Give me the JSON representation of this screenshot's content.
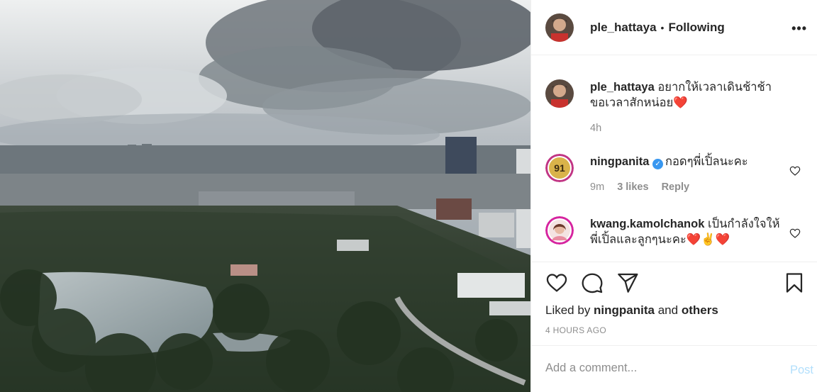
{
  "post": {
    "image_alt": "Aerial view of city skyline over a park with a lake under cloudy sky",
    "author": "ple_hattaya",
    "separator": "•",
    "follow_status": "Following",
    "more_icon": "more-options-icon",
    "caption": "อยากให้เวลาเดินช้าช้า ขอเวลาสักหน่อย❤️",
    "caption_time": "4h"
  },
  "comments": [
    {
      "username": "ningpanita",
      "verified": true,
      "text": "กอดๆพี่เปิ้ลนะคะ",
      "time": "9m",
      "likes": "3 likes",
      "reply": "Reply"
    },
    {
      "username": "kwang.kamolchanok",
      "verified": false,
      "text": "เป็นกำลังใจให้พี่เปิ้ลและลูกๆนะคะ❤️✌️❤️"
    }
  ],
  "actions": {
    "liked_prefix": "Liked by ",
    "liked_user": "ningpanita",
    "liked_and": " and ",
    "liked_others": "others",
    "posted_ago": "4 HOURS AGO"
  },
  "composer": {
    "placeholder": "Add a comment...",
    "post_label": "Post"
  },
  "colors": {
    "text": "#262626",
    "secondary": "#8e8e8e",
    "border": "#efefef",
    "post_disabled": "#b2dffc",
    "heart_red": "#ed4956",
    "verified": "#3897f0"
  }
}
